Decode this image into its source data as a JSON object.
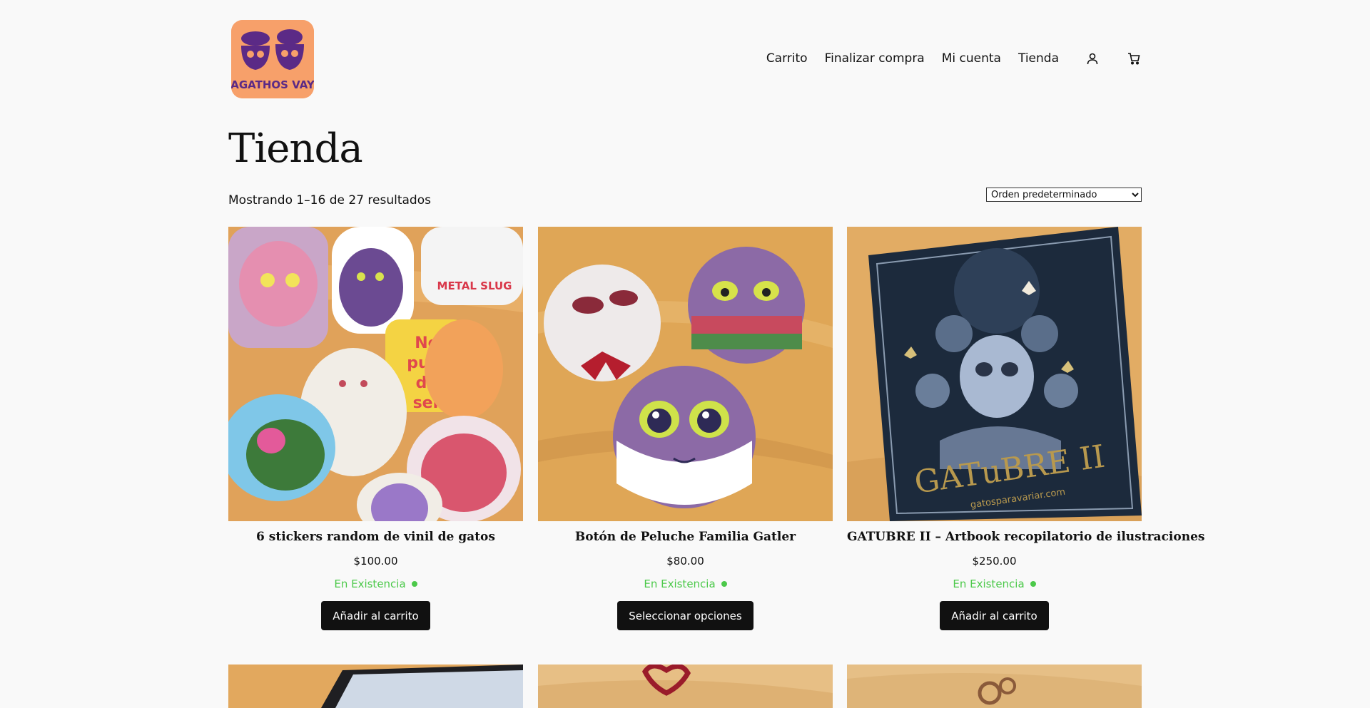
{
  "header": {
    "logo_alt": "AGATHOS VAY",
    "nav": [
      "Carrito",
      "Finalizar compra",
      "Mi cuenta",
      "Tienda"
    ],
    "icons": [
      "account-icon",
      "cart-icon"
    ]
  },
  "page": {
    "title": "Tienda",
    "result_count": "Mostrando 1–16 de 27 resultados",
    "orderby_selected": "Orden predeterminado"
  },
  "products": [
    {
      "title": "6 stickers random de vinil de gatos",
      "price": "$100.00",
      "stock": "En Existencia",
      "button": "Añadir al carrito"
    },
    {
      "title": "Botón de Peluche Familia Gatler",
      "price": "$80.00",
      "stock": "En Existencia",
      "button": "Seleccionar opciones"
    },
    {
      "title": "GATUBRE II – Artbook recopilatorio de ilustraciones",
      "price": "$250.00",
      "stock": "En Existencia",
      "button": "Añadir al carrito"
    }
  ],
  "colors": {
    "background": "#f9f9f9",
    "button": "#111111",
    "stock": "#4cc94a",
    "logo_bg": "#f7a06a",
    "logo_ink": "#5b2a86"
  }
}
